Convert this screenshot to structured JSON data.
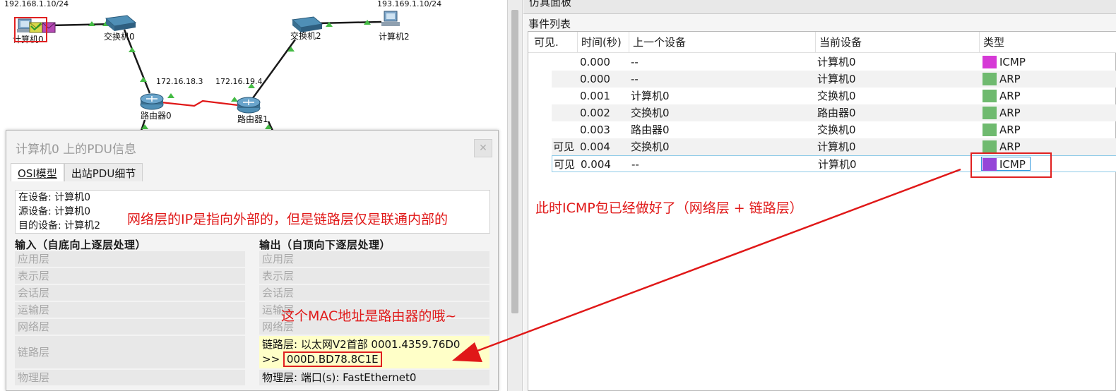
{
  "topology": {
    "pc0_ip": "192.168.1.10/24",
    "pc2_ip": "193.169.1.10/24",
    "pc0_label": "计算机0",
    "pc2_label": "计算机2",
    "switch0_label": "交换机0",
    "switch2_label": "交换机2",
    "router0_label": "路由器0",
    "router1_label": "路由器1",
    "router0_ip": "172.16.18.3",
    "router1_ip": "172.16.19.4"
  },
  "pdu_dialog": {
    "title": "计算机0 上的PDU信息",
    "close_icon": "close-icon",
    "tabs": [
      "OSI模型",
      "出站PDU细节"
    ],
    "at_device": "在设备: 计算机0",
    "src_device": "源设备: 计算机0",
    "dst_device": "目的设备: 计算机2",
    "input_header": "输入（自底向上逐层处理）",
    "output_header": "输出（自顶向下逐层处理）",
    "input_layers": [
      "应用层",
      "表示层",
      "会话层",
      "运输层",
      "网络层",
      "链路层",
      "物理层"
    ],
    "output_layers": [
      "应用层",
      "表示层",
      "会话层",
      "运输层",
      "网络层"
    ],
    "output_link_line1": "链路层: 以太网V2首部 0001.4359.76D0",
    "output_link_prefix": ">>",
    "output_link_mac": "000D.BD78.8C1E",
    "output_physical": "物理层: 端口(s): FastEthernet0"
  },
  "sim_panel": {
    "title": "仿真面板",
    "event_list_label": "事件列表",
    "headers": [
      "可见.",
      "时间(秒)",
      "上一个设备",
      "当前设备",
      "类型"
    ],
    "events": [
      {
        "visible": "",
        "time": "0.000",
        "prev": "--",
        "current": "计算机0",
        "type": "ICMP",
        "color": "#d63ad6"
      },
      {
        "visible": "",
        "time": "0.000",
        "prev": "--",
        "current": "计算机0",
        "type": "ARP",
        "color": "#6fba6f"
      },
      {
        "visible": "",
        "time": "0.001",
        "prev": "计算机0",
        "current": "交换机0",
        "type": "ARP",
        "color": "#6fba6f"
      },
      {
        "visible": "",
        "time": "0.002",
        "prev": "交换机0",
        "current": "路由器0",
        "type": "ARP",
        "color": "#6fba6f"
      },
      {
        "visible": "",
        "time": "0.003",
        "prev": "路由器0",
        "current": "交换机0",
        "type": "ARP",
        "color": "#6fba6f"
      },
      {
        "visible": "可见",
        "time": "0.004",
        "prev": "交换机0",
        "current": "计算机0",
        "type": "ARP",
        "color": "#6fba6f"
      },
      {
        "visible": "可见",
        "time": "0.004",
        "prev": "--",
        "current": "计算机0",
        "type": "ICMP",
        "color": "#9546d8"
      }
    ]
  },
  "annotations": {
    "network_note": "网络层的IP是指向外部的，但是链路层仅是联通内部的",
    "mac_note": "这个MAC地址是路由器的哦~",
    "icmp_note": "此时ICMP包已经做好了（网络层 + 链路层）"
  },
  "colors": {
    "annotation_red": "#e01818",
    "link_green": "#1a1a1a",
    "serial_red": "#e01818"
  }
}
